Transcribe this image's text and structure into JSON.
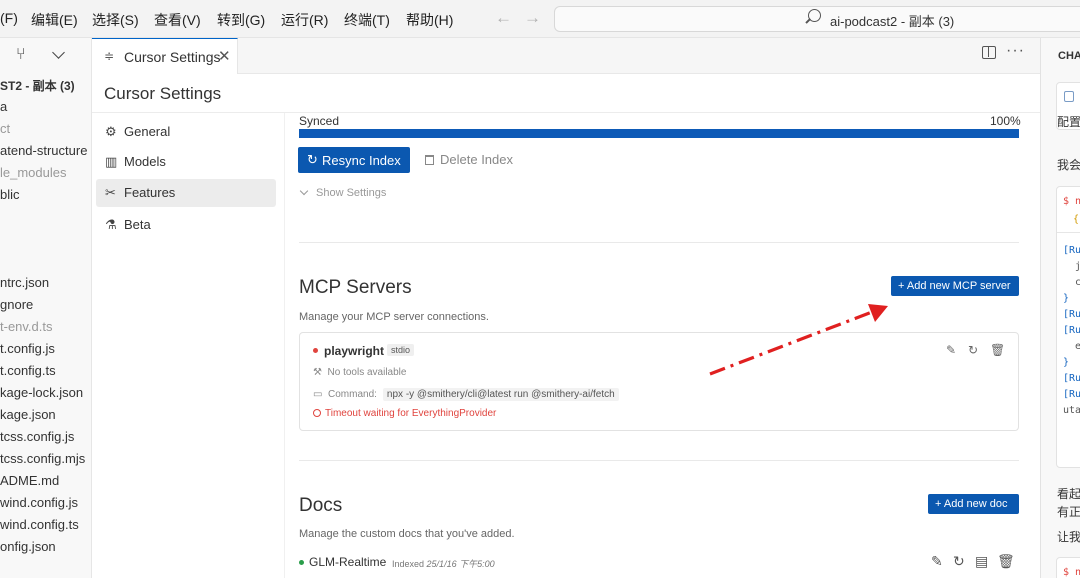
{
  "menubar": {
    "items": [
      "(F)",
      "编辑(E)",
      "选择(S)",
      "查看(V)",
      "转到(G)",
      "运行(R)",
      "终端(T)",
      "帮助(H)"
    ],
    "search_text": "ai-podcast2 - 副本 (3)"
  },
  "explorer": {
    "files": [
      "ST2 - 副本 (3)",
      "a",
      "ct",
      "atend-structure",
      "le_modules",
      "blic",
      "",
      "",
      "",
      "ntrc.json",
      "gnore",
      "t-env.d.ts",
      "t.config.js",
      "t.config.ts",
      "kage-lock.json",
      "kage.json",
      "tcss.config.js",
      "tcss.config.mjs",
      "ADME.md",
      "wind.config.js",
      "wind.config.ts",
      "onfig.json"
    ]
  },
  "tab": {
    "label": "Cursor Settings"
  },
  "settings": {
    "title": "Cursor Settings",
    "nav": [
      {
        "label": "General",
        "icon": "gear-icon"
      },
      {
        "label": "Models",
        "icon": "bar-chart-icon"
      },
      {
        "label": "Features",
        "icon": "tools-icon"
      },
      {
        "label": "Beta",
        "icon": "flask-icon"
      }
    ],
    "index": {
      "status": "Synced",
      "percent_label": "100%",
      "progress": 1.0,
      "resync_label": "Resync Index",
      "delete_label": "Delete Index",
      "show_settings_label": "Show Settings"
    },
    "mcp": {
      "title": "MCP Servers",
      "description": "Manage your MCP server connections.",
      "add_label": "+ Add new MCP server",
      "server": {
        "name": "playwright",
        "transport": "stdio",
        "tools_text": "No tools available",
        "command_label": "Command:",
        "command": "npx -y @smithery/cli@latest run @smithery-ai/fetch",
        "error": "Timeout waiting for EverythingProvider"
      }
    },
    "docs": {
      "title": "Docs",
      "description": "Manage the custom docs that you've added.",
      "add_label": "+ Add new doc",
      "item": {
        "name": "GLM-Realtime",
        "indexed_label": "Indexed",
        "indexed_date": "25/1/16 下午5:00"
      }
    }
  },
  "chat": {
    "title": "CHA",
    "line1": "配置",
    "line2": "我会",
    "line3": "看起",
    "line4": "有正",
    "line5": "让我",
    "code_lines": [
      "$ n",
      "{",
      "[Ru",
      "j",
      "c",
      "}",
      "[Ru",
      "[Ru",
      "e",
      "}",
      "[Ru",
      "[Ru",
      "uta"
    ],
    "bottom_code": "$ n"
  },
  "colors": {
    "accent": "#0b58b0",
    "error": "#e0443e",
    "ok": "#2a9d4a",
    "annotation_arrow": "#e02020"
  }
}
